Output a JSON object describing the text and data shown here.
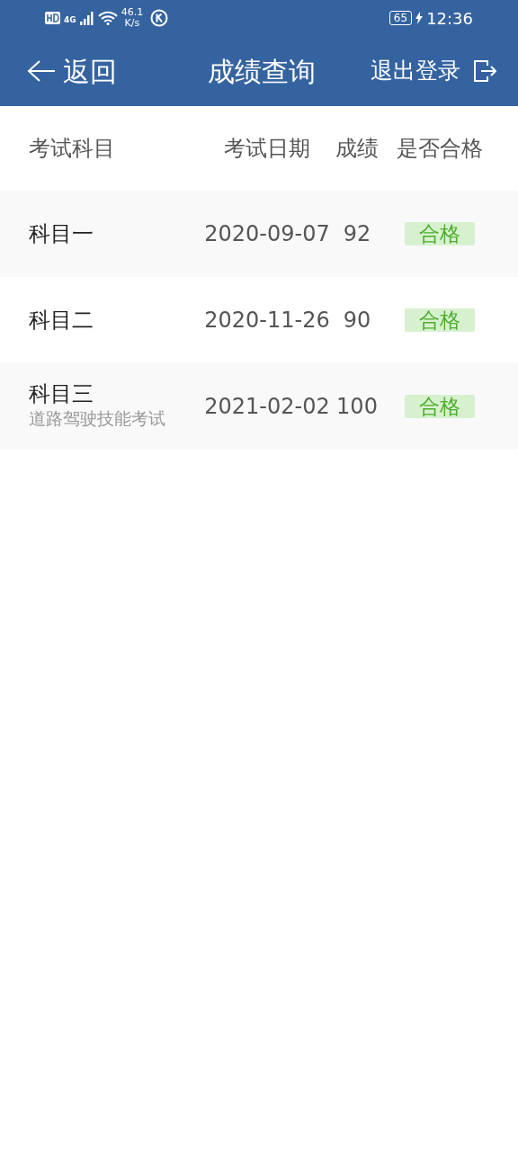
{
  "status_bar": {
    "network": "4G",
    "speed_value": "46.1",
    "speed_unit": "K/s",
    "battery": "65",
    "charging": true,
    "time": "12:36"
  },
  "app_bar": {
    "back": "返回",
    "title": "成绩查询",
    "logout": "退出登录"
  },
  "table": {
    "columns": [
      "考试科目",
      "考试日期",
      "成绩",
      "是否合格"
    ],
    "rows": [
      {
        "subject": "科目一",
        "date": "2020-09-07",
        "score": "92",
        "result": "合格",
        "passed": true
      },
      {
        "subject": "科目二",
        "date": "2020-11-26",
        "score": "90",
        "result": "合格",
        "passed": true
      },
      {
        "subject": "科目三",
        "subtitle": "道路驾驶技能考试",
        "date": "2021-02-02",
        "score": "100",
        "result": "合格",
        "passed": true
      }
    ]
  }
}
